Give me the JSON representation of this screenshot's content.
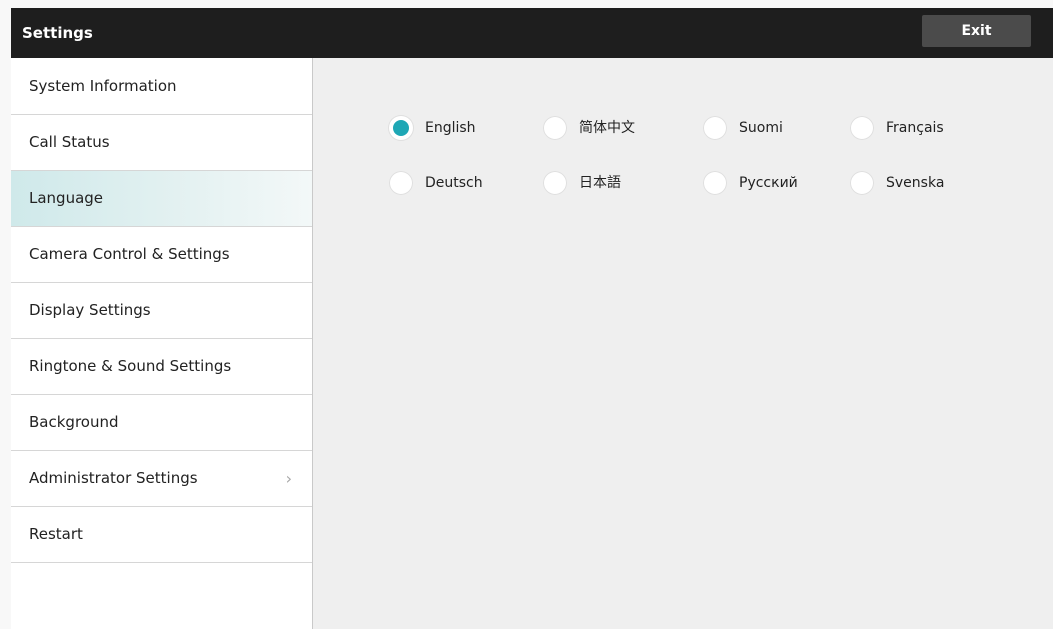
{
  "header": {
    "title": "Settings",
    "exit_label": "Exit"
  },
  "sidebar": {
    "items": [
      {
        "label": "System Information"
      },
      {
        "label": "Call Status"
      },
      {
        "label": "Language"
      },
      {
        "label": "Camera Control & Settings"
      },
      {
        "label": "Display Settings"
      },
      {
        "label": "Ringtone & Sound Settings"
      },
      {
        "label": "Background"
      },
      {
        "label": "Administrator Settings"
      },
      {
        "label": "Restart"
      }
    ],
    "selected": "Language"
  },
  "languages": [
    {
      "label": "English"
    },
    {
      "label": "简体中文"
    },
    {
      "label": "Suomi"
    },
    {
      "label": "Français"
    },
    {
      "label": "Deutsch"
    },
    {
      "label": "日本語"
    },
    {
      "label": "Русский"
    },
    {
      "label": "Svenska"
    }
  ],
  "selected_language": "English",
  "colors": {
    "accent": "#1ea7b5",
    "topbar": "#1e1e1e",
    "selected_row": "#cfe9ea"
  }
}
